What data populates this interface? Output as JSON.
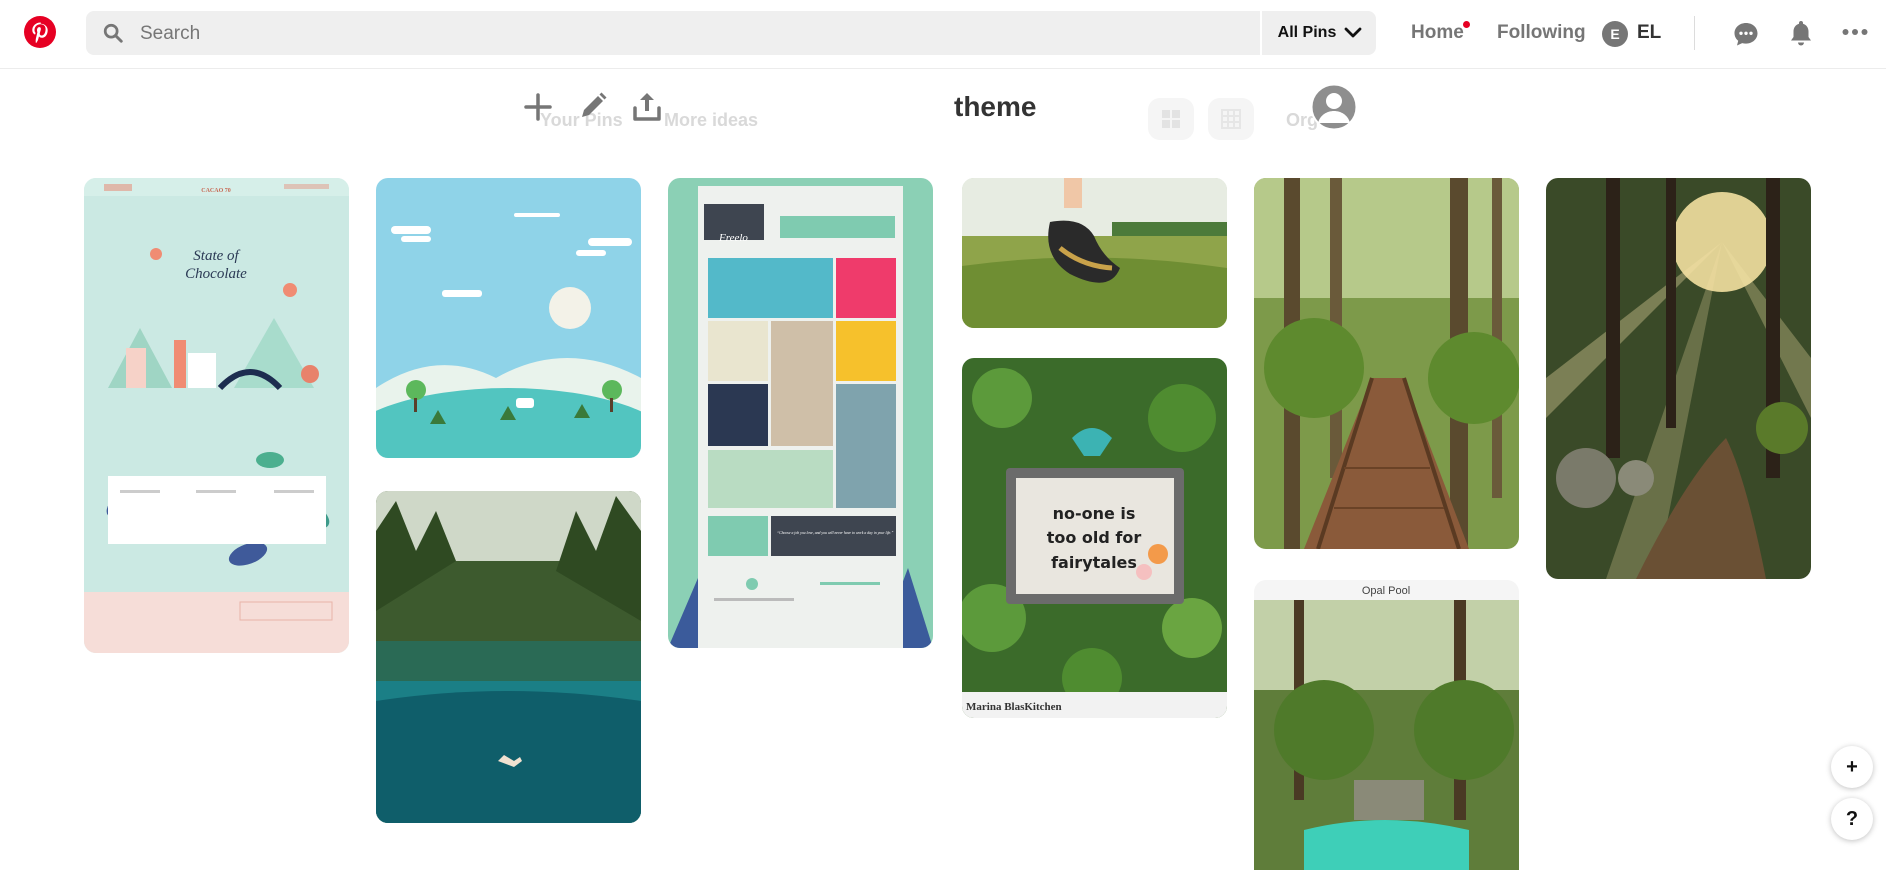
{
  "header": {
    "search_placeholder": "Search",
    "filter_label": "All Pins",
    "nav": {
      "home": "Home",
      "following": "Following"
    },
    "user": {
      "initial": "E",
      "name": "EL"
    },
    "icons": [
      "pinterest-logo",
      "search-icon",
      "chevron-down-icon",
      "messages-icon",
      "notifications-icon",
      "more-icon"
    ],
    "home_notification_color": "#e60023"
  },
  "board": {
    "title": "theme",
    "tool_icons": [
      "add-icon",
      "edit-icon",
      "share-icon",
      "profile-avatar"
    ],
    "faded_tabs": [
      "Your Pins",
      "More ideas",
      "Org"
    ]
  },
  "pins": {
    "opal_pool_caption": "Opal Pool",
    "fairytale_caption": "Marina BlasKitchen",
    "fairytale_board_text": [
      "no-one is",
      "too old for",
      "fairytales"
    ],
    "cacao_title": "CACAO 70",
    "cacao_headline": [
      "State of",
      "Chocolate"
    ],
    "freelo_label": "Freelo",
    "freelo_quote": "“Choose a job you love, and you will never have to work a day in your life.”"
  },
  "floating": {
    "add_label": "+",
    "help_label": "?"
  },
  "colors": {
    "brand": "#e60023",
    "muted_text": "#767676",
    "search_bg": "#efefef"
  }
}
